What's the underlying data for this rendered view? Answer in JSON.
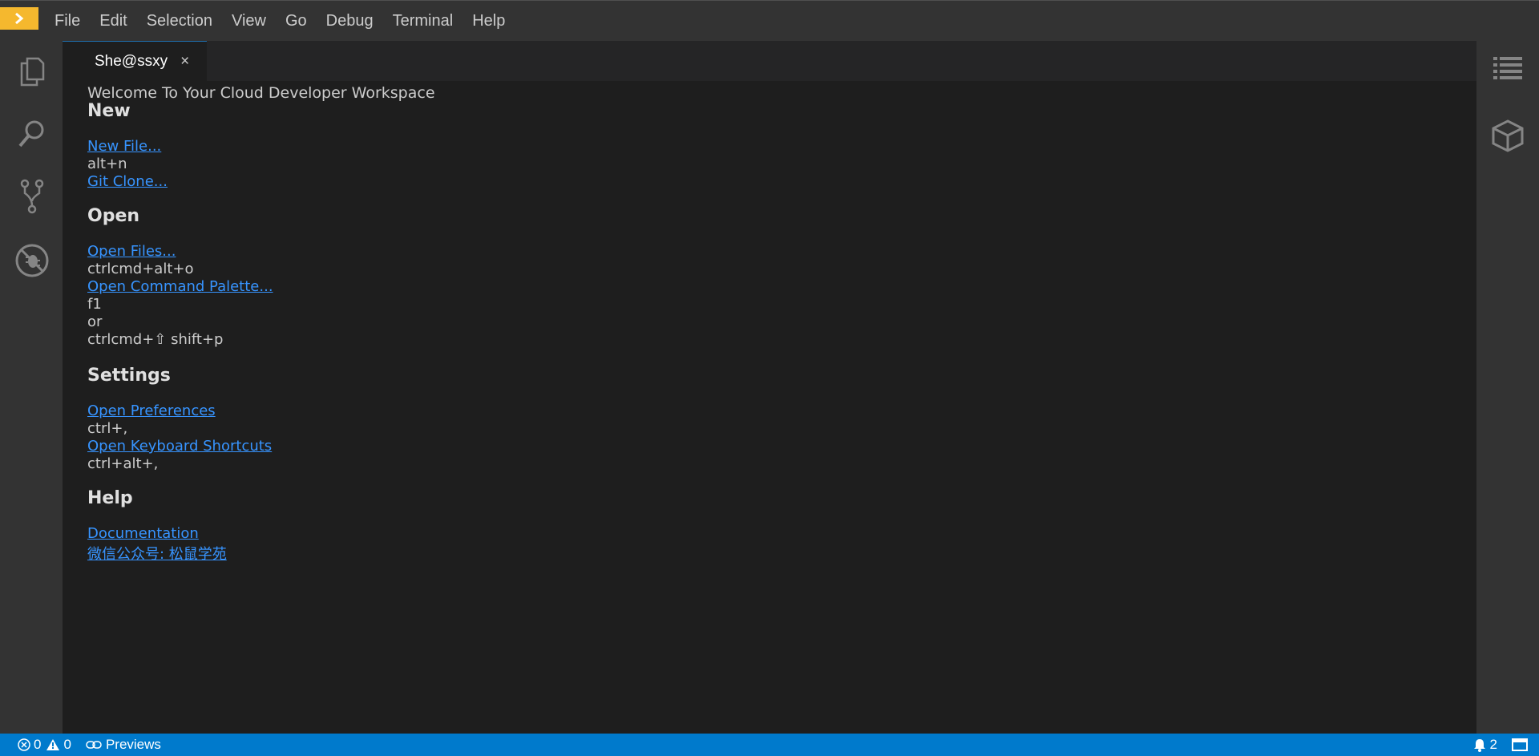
{
  "menubar": {
    "items": [
      "File",
      "Edit",
      "Selection",
      "View",
      "Go",
      "Debug",
      "Terminal",
      "Help"
    ]
  },
  "activitybar": {
    "icons": [
      "explorer-icon",
      "search-icon",
      "source-control-icon",
      "debug-icon"
    ]
  },
  "rightbar": {
    "icons": [
      "outline-icon",
      "plugins-icon"
    ]
  },
  "tab": {
    "title": "She@ssxy",
    "close": "×"
  },
  "welcome": {
    "heading": "Welcome To Your Cloud Developer Workspace",
    "sections": {
      "new": {
        "title": "New",
        "new_file": "New File...",
        "new_file_shortcut": "alt+n",
        "git_clone": "Git Clone..."
      },
      "open": {
        "title": "Open",
        "open_files": "Open Files...",
        "open_files_shortcut": "ctrlcmd+alt+o",
        "command_palette": "Open Command Palette...",
        "command_palette_shortcut_1": "f1",
        "or": "or",
        "command_palette_shortcut_2": "ctrlcmd+⇧ shift+p"
      },
      "settings": {
        "title": "Settings",
        "preferences": "Open Preferences",
        "preferences_shortcut": "ctrl+,",
        "keyboard": "Open Keyboard Shortcuts",
        "keyboard_shortcut": "ctrl+alt+,"
      },
      "help": {
        "title": "Help",
        "documentation": "Documentation",
        "wechat": "微信公众号: 松鼠学苑"
      }
    }
  },
  "statusbar": {
    "errors": "0",
    "warnings": "0",
    "previews": "Previews",
    "notifications": "2"
  },
  "colors": {
    "accent": "#007acc",
    "link": "#3794ff",
    "logo": "#f5b82e"
  }
}
